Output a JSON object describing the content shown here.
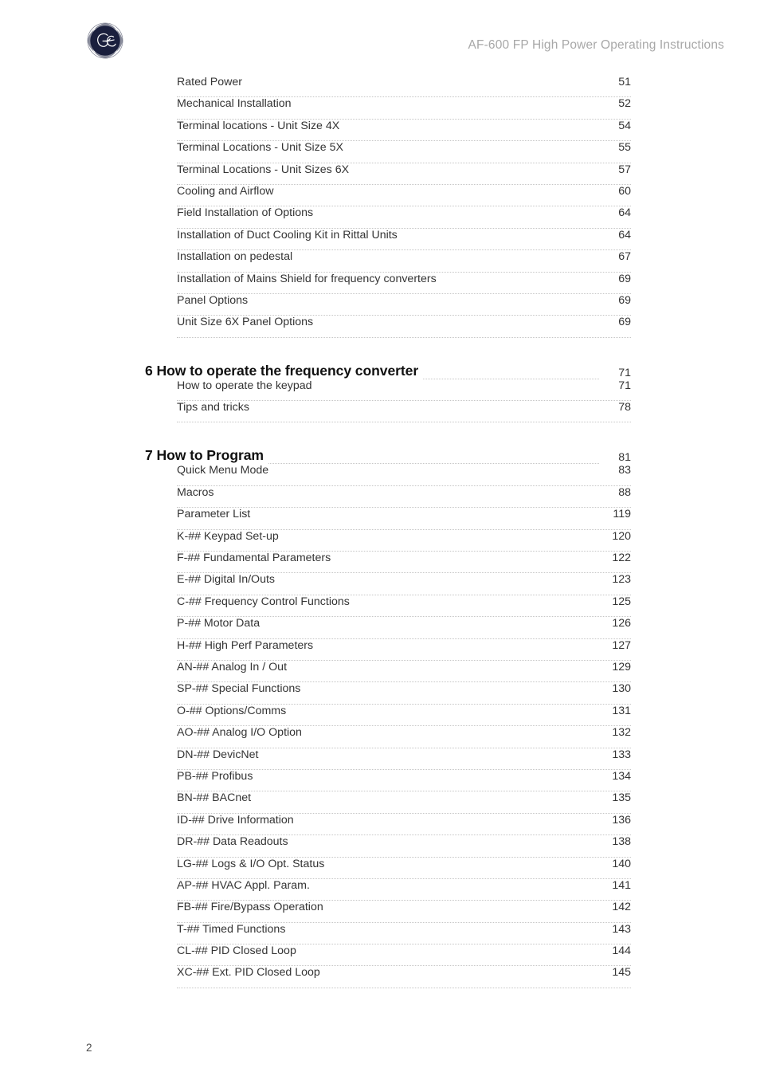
{
  "header": {
    "logo_icon": "ge-monogram-icon",
    "title": "AF-600 FP High Power Operating Instructions"
  },
  "footer": {
    "page_number": "2"
  },
  "colors": {
    "logo_navy": "#1a1f3d",
    "header_text": "#a8a8a8",
    "body_text": "#343434",
    "heading_text": "#111111",
    "leader_dots": "#c6c6c6"
  },
  "toc": {
    "rows": [
      {
        "type": "entry",
        "label": "Rated Power",
        "page": "51"
      },
      {
        "type": "entry",
        "label": "Mechanical Installation",
        "page": "52"
      },
      {
        "type": "entry",
        "label": "Terminal locations - Unit Size 4X",
        "page": "54"
      },
      {
        "type": "entry",
        "label": "Terminal Locations - Unit Size 5X",
        "page": "55"
      },
      {
        "type": "entry",
        "label": "Terminal Locations - Unit Sizes 6X",
        "page": "57"
      },
      {
        "type": "entry",
        "label": "Cooling and Airflow",
        "page": "60"
      },
      {
        "type": "entry",
        "label": "Field Installation of Options",
        "page": "64"
      },
      {
        "type": "entry",
        "label": "Installation of Duct Cooling Kit in Rittal Units",
        "page": "64"
      },
      {
        "type": "entry",
        "label": "Installation on pedestal",
        "page": "67"
      },
      {
        "type": "entry",
        "label": "Installation of Mains Shield for frequency converters",
        "page": "69"
      },
      {
        "type": "entry",
        "label": "Panel Options",
        "page": "69"
      },
      {
        "type": "entry",
        "label": "Unit Size 6X Panel Options",
        "page": "69"
      },
      {
        "type": "chapter",
        "label": "6 How to operate the frequency converter",
        "page": "71"
      },
      {
        "type": "entry",
        "label": "How to operate the keypad",
        "page": "71"
      },
      {
        "type": "entry",
        "label": "Tips and tricks",
        "page": "78"
      },
      {
        "type": "chapter",
        "label": "7 How to Program",
        "page": "81"
      },
      {
        "type": "entry",
        "label": "Quick Menu Mode",
        "page": "83"
      },
      {
        "type": "entry",
        "label": "Macros",
        "page": "88"
      },
      {
        "type": "entry",
        "label": "Parameter List",
        "page": "119"
      },
      {
        "type": "entry",
        "label": "K-## Keypad Set-up",
        "page": "120"
      },
      {
        "type": "entry",
        "label": "F-## Fundamental Parameters",
        "page": "122"
      },
      {
        "type": "entry",
        "label": "E-## Digital In/Outs",
        "page": "123"
      },
      {
        "type": "entry",
        "label": "C-## Frequency Control Functions",
        "page": "125"
      },
      {
        "type": "entry",
        "label": "P-## Motor Data",
        "page": "126"
      },
      {
        "type": "entry",
        "label": "H-## High Perf Parameters",
        "page": "127"
      },
      {
        "type": "entry",
        "label": "AN-## Analog In / Out",
        "page": "129"
      },
      {
        "type": "entry",
        "label": "SP-## Special Functions",
        "page": "130"
      },
      {
        "type": "entry",
        "label": "O-## Options/Comms",
        "page": "131"
      },
      {
        "type": "entry",
        "label": "AO-## Analog I/O Option",
        "page": "132"
      },
      {
        "type": "entry",
        "label": "DN-## DevicNet",
        "page": "133"
      },
      {
        "type": "entry",
        "label": "PB-## Profibus",
        "page": "134"
      },
      {
        "type": "entry",
        "label": "BN-## BACnet",
        "page": "135"
      },
      {
        "type": "entry",
        "label": "ID-## Drive Information",
        "page": "136"
      },
      {
        "type": "entry",
        "label": "DR-## Data Readouts",
        "page": "138"
      },
      {
        "type": "entry",
        "label": "LG-## Logs & I/O Opt. Status",
        "page": "140"
      },
      {
        "type": "entry",
        "label": "AP-## HVAC Appl. Param.",
        "page": "141"
      },
      {
        "type": "entry",
        "label": "FB-## Fire/Bypass Operation",
        "page": "142"
      },
      {
        "type": "entry",
        "label": "T-## Timed Functions",
        "page": "143"
      },
      {
        "type": "entry",
        "label": "CL-## PID Closed Loop",
        "page": "144"
      },
      {
        "type": "entry",
        "label": "XC-## Ext. PID Closed Loop",
        "page": "145"
      }
    ]
  }
}
